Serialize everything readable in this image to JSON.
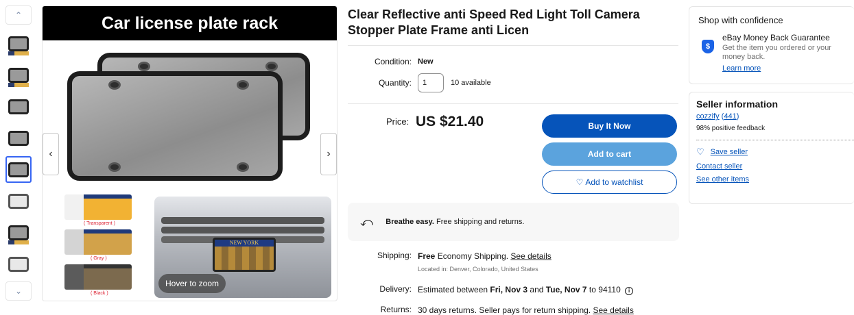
{
  "gallery": {
    "thumbnail_count": 8,
    "active_thumbnail": 5,
    "image_banner": "Car license plate rack",
    "swatch_labels": [
      "( Transparent )",
      "( Gray )",
      "( Black )"
    ],
    "plate_text": "NEW YORK",
    "hover_hint": "Hover to zoom",
    "prev_icon": "chevron-left-icon",
    "next_icon": "chevron-right-icon"
  },
  "product": {
    "title": "Clear Reflective anti Speed Red Light Toll Camera Stopper Plate Frame anti Licen",
    "condition_label": "Condition:",
    "condition_value": "New",
    "quantity_label": "Quantity:",
    "quantity_value": "1",
    "available": "10 available",
    "price_label": "Price:",
    "price_value": "US $21.40",
    "buy_now": "Buy It Now",
    "add_to_cart": "Add to cart",
    "add_to_watchlist": "Add to watchlist",
    "breathe_bold": "Breathe easy.",
    "breathe_text": " Free shipping and returns.",
    "shipping_label": "Shipping:",
    "shipping_bold": "Free",
    "shipping_text": " Economy Shipping. ",
    "shipping_link": "See details",
    "shipping_location": "Located in: Denver, Colorado, United States",
    "delivery_label": "Delivery:",
    "delivery_pre": "Estimated between ",
    "delivery_start": "Fri, Nov 3",
    "delivery_and": " and ",
    "delivery_end": "Tue, Nov 7",
    "delivery_post": " to 94110",
    "returns_label": "Returns:",
    "returns_text": "30 days returns. Seller pays for return shipping. ",
    "returns_link": "See details"
  },
  "confidence": {
    "title": "Shop with confidence",
    "guarantee_title": "eBay Money Back Guarantee",
    "guarantee_text": "Get the item you ordered or your money back.",
    "learn_more": "Learn more",
    "shield_glyph": "$"
  },
  "seller": {
    "title": "Seller information",
    "name": "cozzify",
    "score": "441",
    "feedback": "98% positive feedback",
    "save_seller": "Save seller",
    "contact_seller": "Contact seller",
    "see_other_items": "See other items"
  },
  "colors": {
    "primary_button": "#0654ba",
    "secondary_button": "#5ba3dd",
    "active_thumb_border": "#3665f3"
  }
}
